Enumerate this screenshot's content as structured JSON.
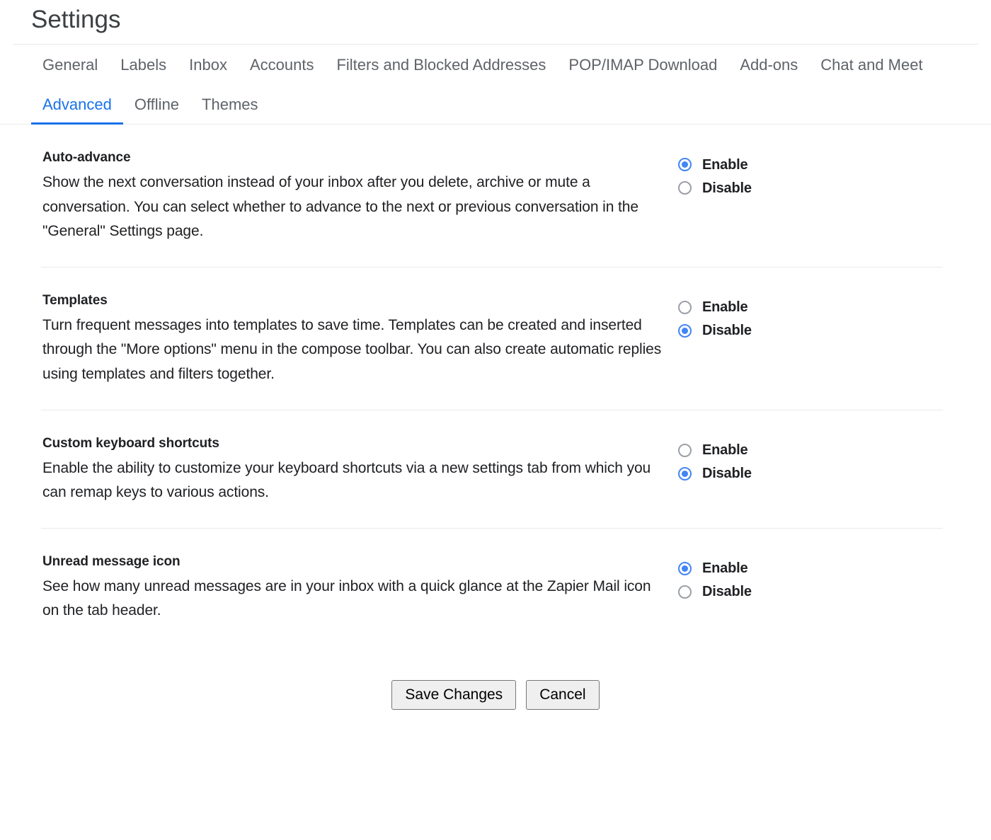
{
  "header": {
    "title": "Settings"
  },
  "tabs": [
    {
      "label": "General",
      "active": false
    },
    {
      "label": "Labels",
      "active": false
    },
    {
      "label": "Inbox",
      "active": false
    },
    {
      "label": "Accounts",
      "active": false
    },
    {
      "label": "Filters and Blocked Addresses",
      "active": false
    },
    {
      "label": "POP/IMAP Download",
      "active": false
    },
    {
      "label": "Add-ons",
      "active": false
    },
    {
      "label": "Chat and Meet",
      "active": false
    },
    {
      "label": "Advanced",
      "active": true
    },
    {
      "label": "Offline",
      "active": false
    },
    {
      "label": "Themes",
      "active": false
    }
  ],
  "accent_color": "#1a73e8",
  "radio_color": "#4285f4",
  "sections": [
    {
      "title": "Auto-advance",
      "description": "Show the next conversation instead of your inbox after you delete, archive or mute a conversation. You can select whether to advance to the next or previous conversation in the \"General\" Settings page.",
      "options": [
        {
          "label": "Enable",
          "selected": true
        },
        {
          "label": "Disable",
          "selected": false
        }
      ]
    },
    {
      "title": "Templates",
      "description": "Turn frequent messages into templates to save time. Templates can be created and inserted through the \"More options\" menu in the compose toolbar. You can also create automatic replies using templates and filters together.",
      "options": [
        {
          "label": "Enable",
          "selected": false
        },
        {
          "label": "Disable",
          "selected": true
        }
      ]
    },
    {
      "title": "Custom keyboard shortcuts",
      "description": "Enable the ability to customize your keyboard shortcuts via a new settings tab from which you can remap keys to various actions.",
      "options": [
        {
          "label": "Enable",
          "selected": false
        },
        {
          "label": "Disable",
          "selected": true
        }
      ]
    },
    {
      "title": "Unread message icon",
      "description": "See how many unread messages are in your inbox with a quick glance at the Zapier Mail icon on the tab header.",
      "options": [
        {
          "label": "Enable",
          "selected": true
        },
        {
          "label": "Disable",
          "selected": false
        }
      ]
    }
  ],
  "footer": {
    "save_label": "Save Changes",
    "cancel_label": "Cancel"
  }
}
